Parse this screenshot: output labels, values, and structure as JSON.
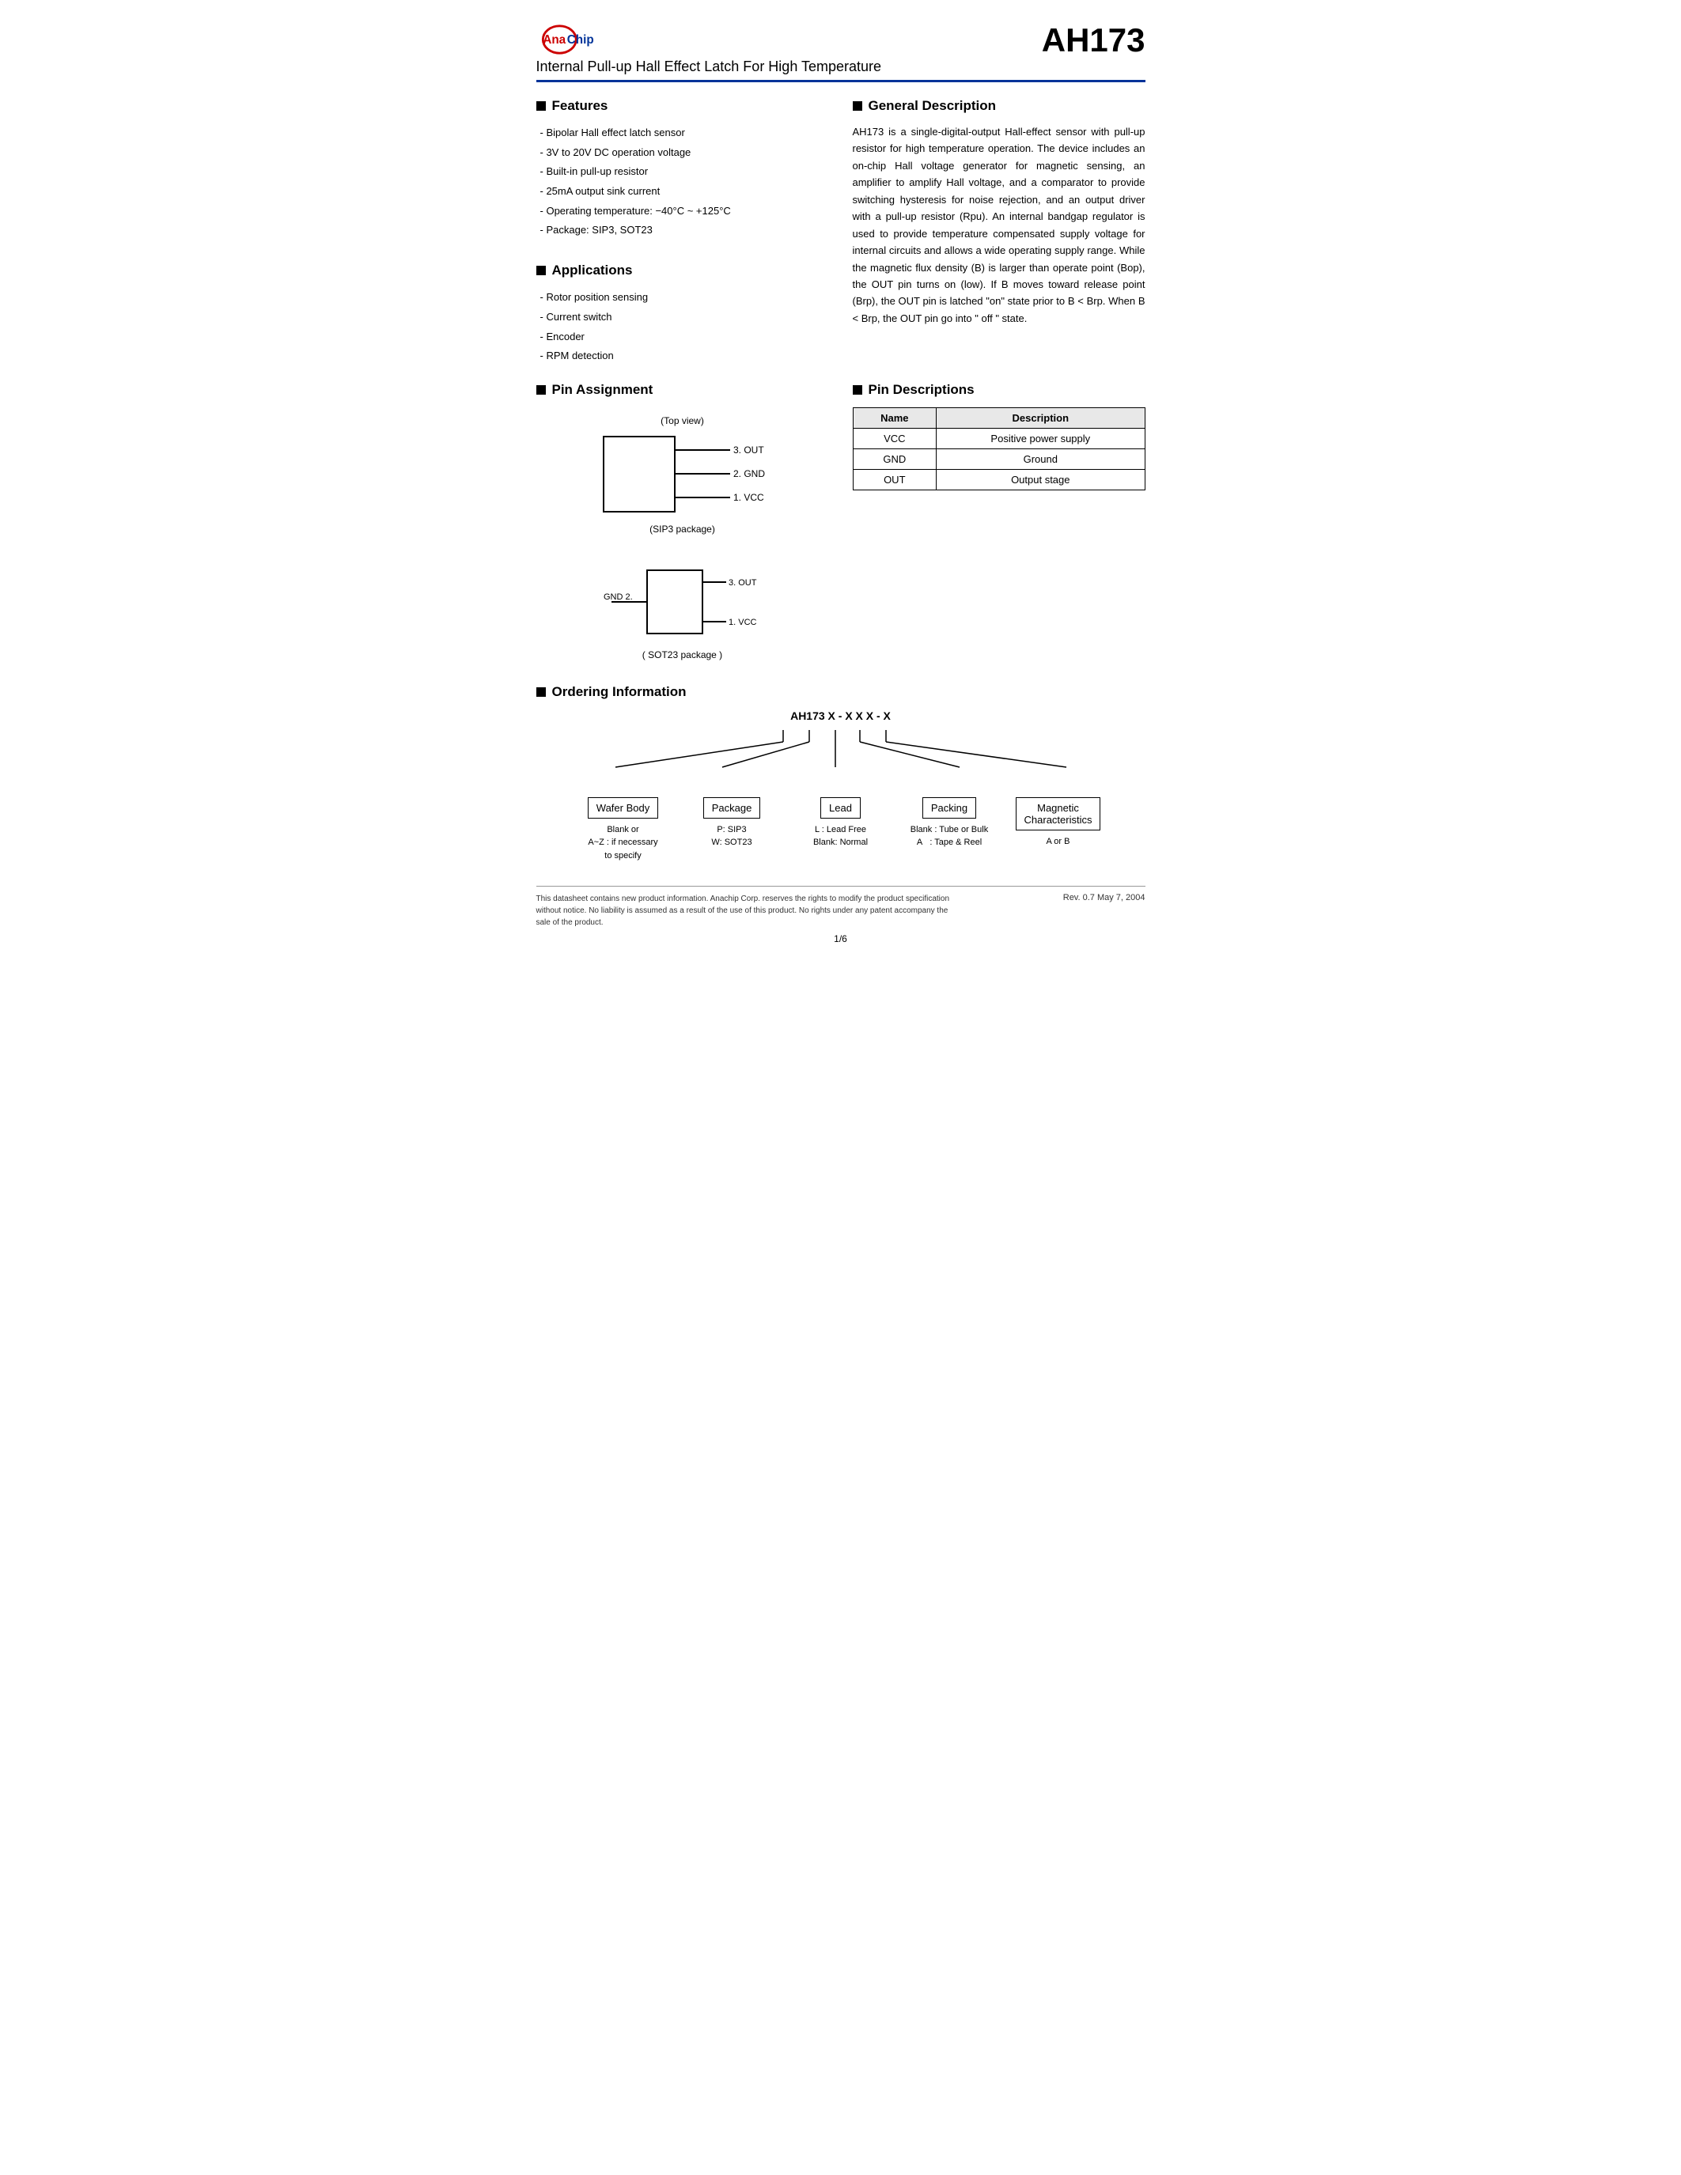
{
  "header": {
    "logo_text": "AnaChip",
    "chip_id": "AH173",
    "subtitle": "Internal Pull-up Hall Effect Latch For High Temperature"
  },
  "features": {
    "title": "Features",
    "items": [
      "Bipolar Hall effect latch sensor",
      "3V to 20V DC operation voltage",
      "Built-in pull-up resistor",
      "25mA output sink current",
      "Operating temperature:  −40°C ~ +125°C",
      "Package: SIP3, SOT23"
    ]
  },
  "general_description": {
    "title": "General Description",
    "text": "AH173 is a single-digital-output Hall-effect sensor with pull-up resistor for high temperature operation. The device includes an on-chip Hall voltage generator for magnetic sensing, an amplifier to amplify Hall voltage, and a comparator to provide switching hysteresis for noise rejection, and an output driver with a pull-up resistor (Rpu). An internal bandgap regulator is used to provide temperature compensated supply voltage for internal circuits and allows a wide operating supply range. While the magnetic flux density (B) is larger than operate point (Bop), the OUT pin turns on (low). If B moves toward release point (Brp), the OUT pin is latched \"on\" state prior to B < Brp. When B < Brp, the OUT pin go into \" off \" state."
  },
  "applications": {
    "title": "Applications",
    "items": [
      "Rotor position sensing",
      "Current switch",
      "Encoder",
      "RPM detection"
    ]
  },
  "pin_assignment": {
    "title": "Pin Assignment",
    "top_view_label": "(Top view)",
    "sip3_pins": [
      {
        "num": "3",
        "name": "OUT"
      },
      {
        "num": "2",
        "name": "GND"
      },
      {
        "num": "1",
        "name": "VCC"
      }
    ],
    "sip3_label": "(SIP3 package)",
    "sot23_pins": {
      "left": {
        "num": "2",
        "name": "GND"
      },
      "right_top": {
        "num": "3",
        "name": "OUT"
      },
      "right_bot": {
        "num": "1",
        "name": "VCC"
      }
    },
    "sot23_label": "( SOT23 package )"
  },
  "pin_descriptions": {
    "title": "Pin Descriptions",
    "headers": [
      "Name",
      "Description"
    ],
    "rows": [
      {
        "name": "VCC",
        "desc": "Positive power supply"
      },
      {
        "name": "GND",
        "desc": "Ground"
      },
      {
        "name": "OUT",
        "desc": "Output stage"
      }
    ]
  },
  "ordering": {
    "title": "Ordering Information",
    "part_number_display": "AH173 X - X X X - X",
    "boxes": [
      {
        "label": "Wafer Body",
        "desc": "Blank or\nA~Z : if necessary\nto specify"
      },
      {
        "label": "Package",
        "desc": "P: SIP3\nW: SOT23"
      },
      {
        "label": "Lead",
        "desc": "L : Lead Free\nBlank: Normal"
      },
      {
        "label": "Packing",
        "desc": "Blank : Tube or Bulk\nA    : Tape & Reel"
      },
      {
        "label": "Magnetic\nCharacteristics",
        "desc": "A or B"
      }
    ]
  },
  "footer": {
    "disclaimer": "This datasheet contains new product information. Anachip Corp. reserves the rights to modify the product specification without notice. No liability is assumed as a result of the use of this product. No rights under any patent accompany the sale of the product.",
    "revision": "Rev. 0.7  May 7, 2004",
    "page": "1/6"
  }
}
